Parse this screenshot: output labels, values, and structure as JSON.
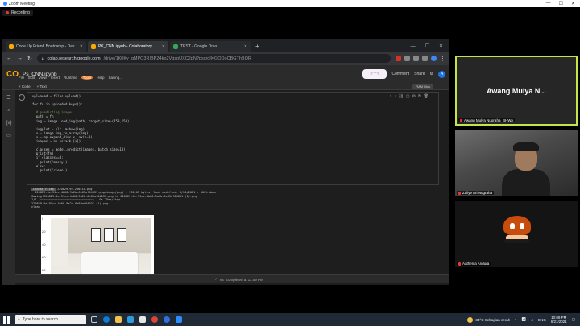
{
  "zoom": {
    "title": "Zoom Meeting",
    "recording_label": "Recording"
  },
  "browser": {
    "tabs": [
      {
        "label": "Code Up Friend Bootcamp - Des",
        "color": "#f9ab00",
        "active": false
      },
      {
        "label": "PK_CNN.ipynb - Colaboratory",
        "color": "#f9ab00",
        "active": true
      },
      {
        "label": "TEST - Google Drive",
        "color": "#34a853",
        "active": false
      }
    ],
    "url_host": "colab.research.google.com",
    "url_path": "/drive/1K0Ky_gMPQ3RIBPZ4ko2VqspUXC2pN?pscroll=GODoCBGThBOR"
  },
  "colab": {
    "logo": "CO",
    "notebook_title": "Ps_CNN.ipynb",
    "menu": [
      "File",
      "Edit",
      "View",
      "Insert",
      "Runtime",
      "Tools",
      "Help",
      "Saving..."
    ],
    "comment": "Comment",
    "share": "Share",
    "avatar_letter": "A",
    "add_code": "+ Code",
    "add_text": "+ Text",
    "ram_disk": "RAM Disk",
    "status_text": "completed at 11:09 PM",
    "status_time": "9s"
  },
  "code_cell": {
    "lines": [
      "uploaded = files.upload()",
      "",
      "for fn in uploaded.keys():",
      "",
      "  # predicting images",
      "  path = fn",
      "  img = image.load_img(path, target_size=(150,150))",
      "",
      "  imgplot = plt.imshow(img)",
      "  x = image.img_to_array(img)",
      "  x = np.expand_dims(x, axis=0)",
      "  images = np.vstack([x])",
      "",
      "  classes = model.predict(images, batch_size=10)",
      "  print(fn)",
      "  if classes==0:",
      "    print('messy')",
      "  else:",
      "    print('clean')"
    ]
  },
  "output": {
    "chooser_label": "Choose Files",
    "chosen_file": "220829-9e-200531.png",
    "lines": [
      "• 220829-4e-91cc-4b60-9a2b-6e89af04031.png(image/png) - 131105 bytes, last modified: 8/20/2021 - 100% done",
      "Saving 220829-4e-91cc-4b60-9a2b-6e89af04031.png to 220829-4e-91cc-4b60-9a2b-6e89af04031 (1).png",
      "1/1 [==============================] - 0s 25ms/step",
      "220829-4e-91cc-4b60-9a2b-6e89af04031 (1).png",
      "clean"
    ],
    "y_ticks": [
      "0",
      "20",
      "40",
      "60",
      "80"
    ]
  },
  "participants": [
    {
      "display": "Awang Mulya N...",
      "label": "Awang Mulya Nugraha_BHWA",
      "type": "name"
    },
    {
      "label": "Zaliye Ari Nugraha",
      "type": "video"
    },
    {
      "label": "Aathenia Andura",
      "type": "avatar"
    }
  ],
  "taskbar": {
    "search_placeholder": "Type here to search",
    "weather": "34°C Sebagian cerah",
    "lang": "ENG",
    "time": "10:09 PM",
    "date": "6/21/2021"
  },
  "colors": {
    "accent_speaker": "#c5e34b",
    "colab_orange": "#f9ab00",
    "recording_red": "#e53935"
  }
}
